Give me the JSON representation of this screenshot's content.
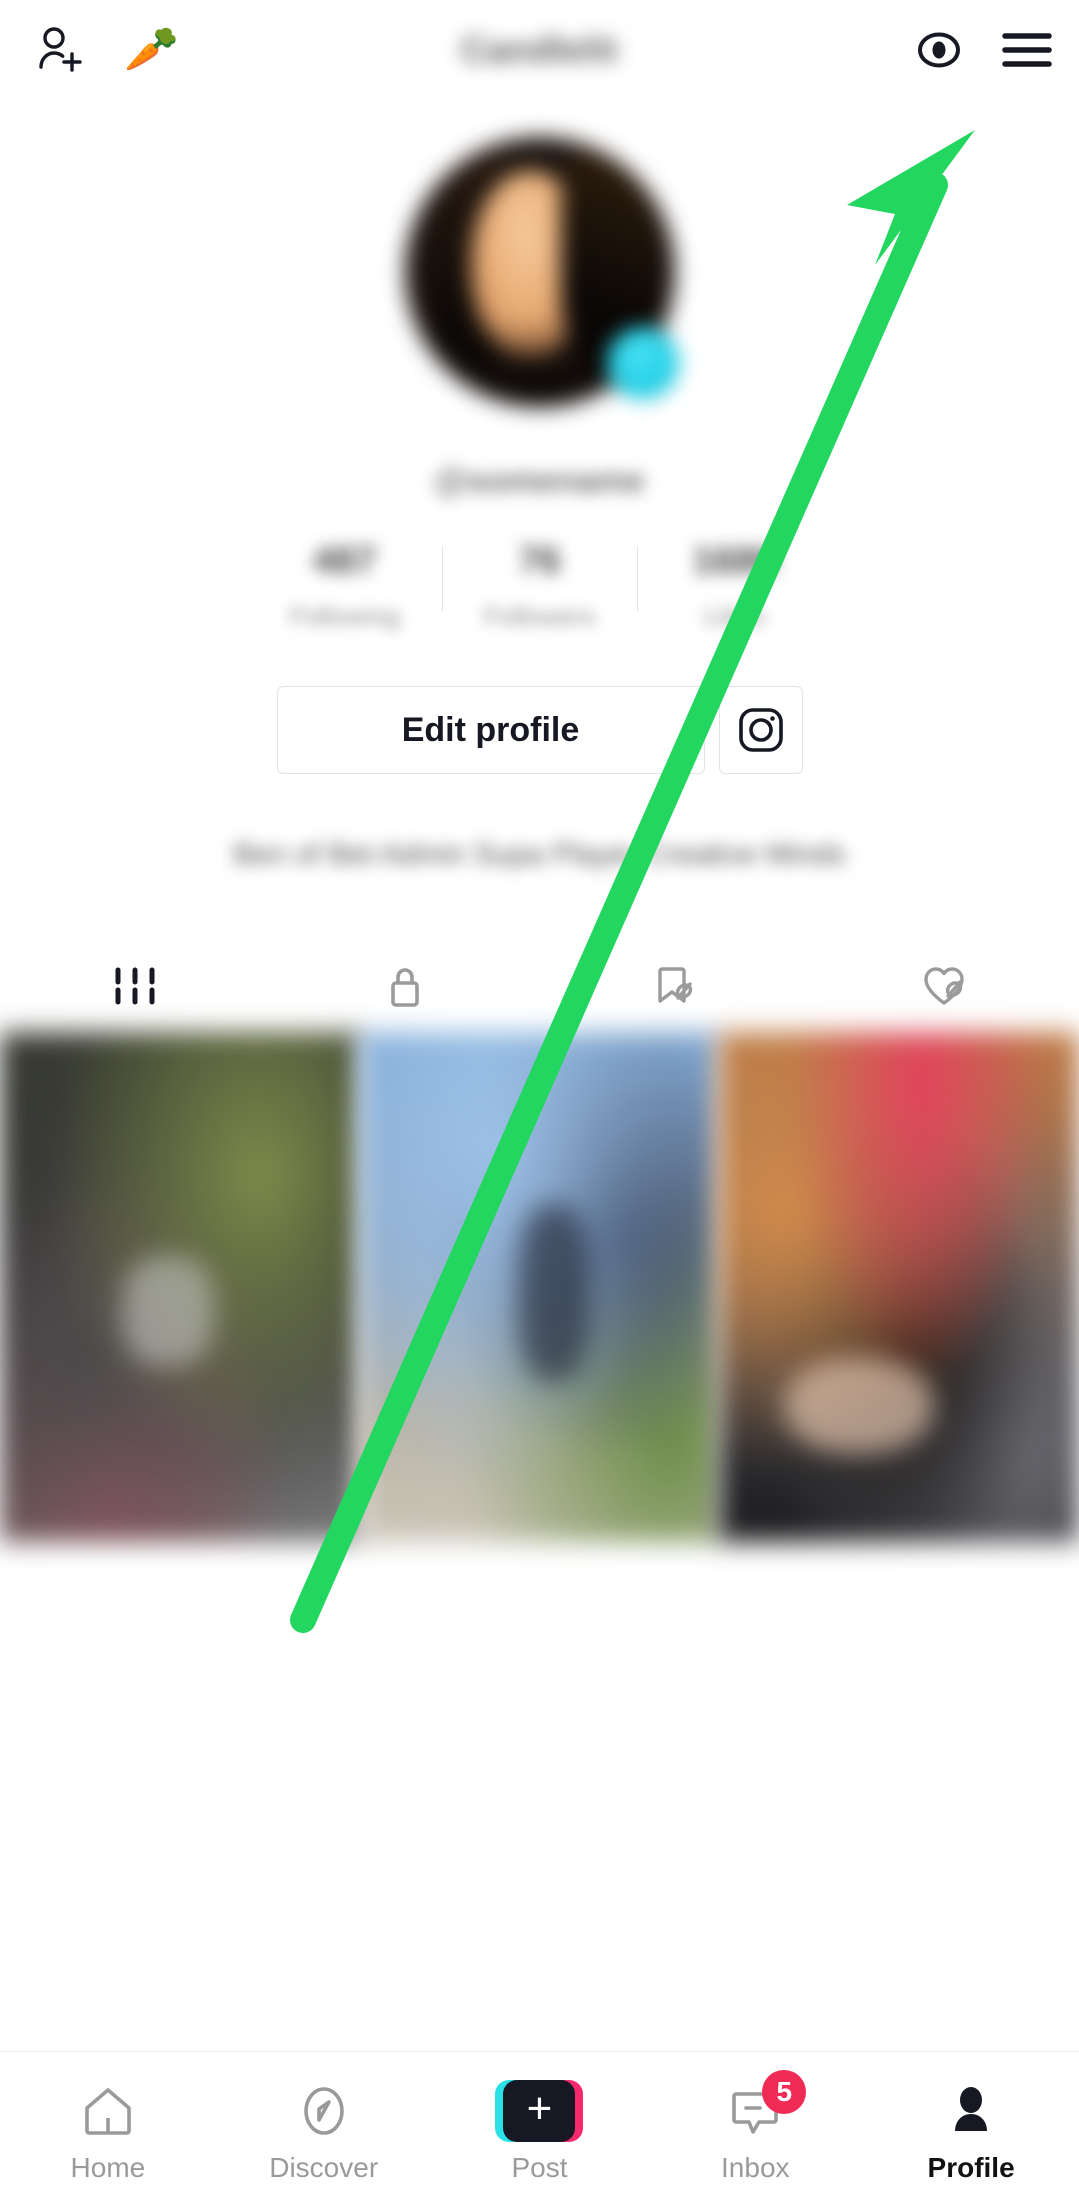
{
  "header": {
    "add_person_icon": "add-person-icon",
    "emoji": "🥕",
    "title": "Candlelit",
    "eye_icon": "eye-icon",
    "menu_icon": "hamburger-menu-icon"
  },
  "profile": {
    "handle": "@somename",
    "avatar_alt": "profile-avatar",
    "badge_alt": "story-badge",
    "stats": [
      {
        "value": "487",
        "label": "Following"
      },
      {
        "value": "76",
        "label": "Followers"
      },
      {
        "value": "1686",
        "label": "Likes"
      }
    ],
    "edit_button": "Edit profile",
    "instagram_icon": "instagram-icon",
    "bio": "Ben of Bet Admin Supa Player Creative Minds"
  },
  "tabs": [
    {
      "icon": "grid-icon",
      "active": true
    },
    {
      "icon": "lock-icon",
      "active": false
    },
    {
      "icon": "bookmark-hidden-icon",
      "active": false
    },
    {
      "icon": "heart-hidden-icon",
      "active": false
    }
  ],
  "grid": {
    "cells": [
      "video-thumbnail-1",
      "video-thumbnail-2",
      "video-thumbnail-3"
    ]
  },
  "annotation": {
    "arrow_color": "#22d65f",
    "arrow_alt": "green-pointer-arrow"
  },
  "bottom_nav": [
    {
      "label": "Home",
      "icon": "home-icon",
      "active": false,
      "badge": ""
    },
    {
      "label": "Discover",
      "icon": "compass-icon",
      "active": false,
      "badge": ""
    },
    {
      "label": "Post",
      "icon": "plus-icon",
      "active": false,
      "badge": ""
    },
    {
      "label": "Inbox",
      "icon": "inbox-icon",
      "active": false,
      "badge": "5"
    },
    {
      "label": "Profile",
      "icon": "person-icon",
      "active": true,
      "badge": ""
    }
  ],
  "colors": {
    "accent_cyan": "#2ce0e8",
    "accent_pink": "#f5296b",
    "badge_red": "#f02c56",
    "annotation_green": "#22d65f",
    "text_dark": "#161823",
    "text_muted": "#9a9a9a"
  }
}
